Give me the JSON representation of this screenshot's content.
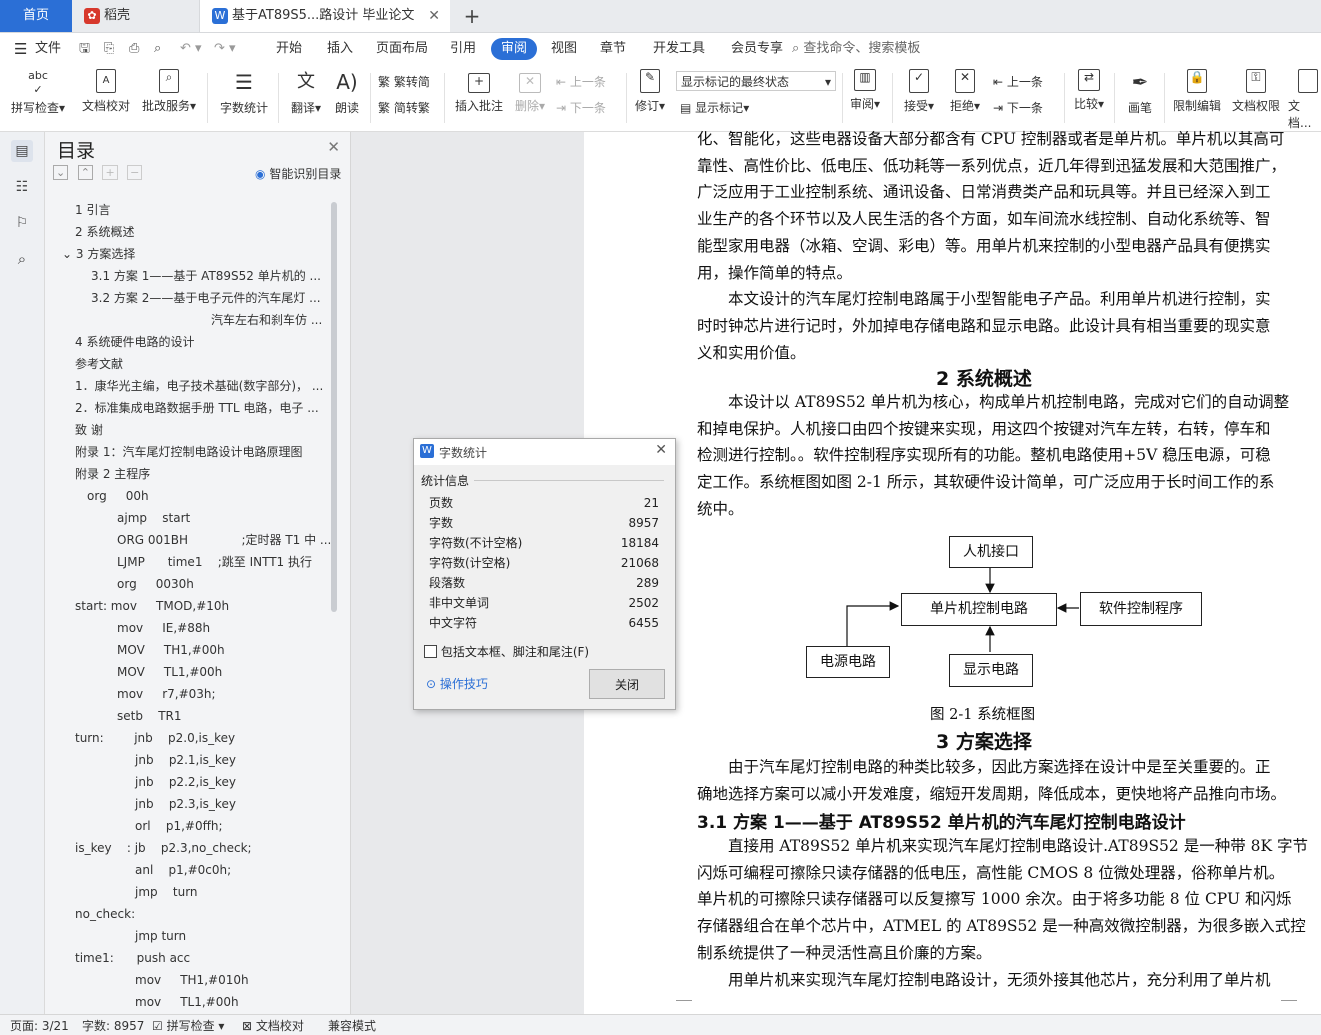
{
  "tabs": [
    {
      "label": "首页"
    },
    {
      "label": "稻壳"
    },
    {
      "label": "基于AT89S5...路设计 毕业论文"
    }
  ],
  "menu": [
    "文件",
    "开始",
    "插入",
    "页面布局",
    "引用",
    "审阅",
    "视图",
    "章节",
    "开发工具",
    "会员专享"
  ],
  "menu_search": "查找命令、搜索模板",
  "ribbon": {
    "spell": "拼写检查",
    "proof": "文档校对",
    "annotate": "批改服务",
    "wordcount": "字数统计",
    "translate": "翻译",
    "read": "朗读",
    "to_trad": "繁转简",
    "to_simp": "简转繁",
    "insert_comment": "插入批注",
    "delete": "删除",
    "prev": "上一条",
    "next": "下一条",
    "revise": "修订",
    "markup_state": "显示标记的最终状态",
    "show_markup": "显示标记",
    "review": "审阅",
    "accept": "接受",
    "reject": "拒绝",
    "prev2": "上一条",
    "next2": "下一条",
    "compare": "比较",
    "pen": "画笔",
    "restrict": "限制编辑",
    "permission": "文档权限",
    "doc_cut": "文档..."
  },
  "toc": {
    "title": "目录",
    "smart": "智能识别目录",
    "items": [
      "1 引言",
      "2 系统概述",
      "3 方案选择",
      "3.1 方案 1——基于 AT89S52 单片机的 ...",
      "3.2 方案 2——基于电子元件的汽车尾灯 ...",
      "汽车左右和刹车仿 ...",
      "4 系统硬件电路的设计",
      "参考文献",
      "1．康华光主编，电子技术基础(数字部分)， ...",
      "2．标准集成电路数据手册 TTL 电路，电子 ...",
      "致 谢",
      "附录 1：汽车尾灯控制电路设计电路原理图",
      "附录 2 主程序",
      "org     00h",
      "ajmp    start",
      "ORG 001BH              ;定时器 T1 中 ...",
      "LJMP      time1    ;跳至 INTT1 执行",
      "org     0030h",
      "start: mov     TMOD,#10h",
      "mov     IE,#88h",
      "MOV     TH1,#00h",
      "MOV     TL1,#00h",
      "mov     r7,#03h;",
      "setb    TR1",
      "turn:        jnb    p2.0,is_key",
      "jnb    p2.1,is_key",
      "jnb    p2.2,is_key",
      "jnb    p2.3,is_key",
      "orl    p1,#0ffh;",
      "is_key    : jb    p2.3,no_check;",
      "anl    p1,#0c0h;",
      "jmp    turn",
      "no_check:",
      "jmp turn",
      "time1:      push acc",
      "mov     TH1,#010h",
      "mov     TL1,#00h"
    ]
  },
  "doc": {
    "p1_lines": [
      "化、智能化，这些电器设备大部分都含有 CPU 控制器或者是单片机。单片机以其高可",
      "靠性、高性价比、低电压、低功耗等一系列优点，近几年得到迅猛发展和大范围推广，",
      "广泛应用于工业控制系统、通讯设备、日常消费类产品和玩具等。并且已经深入到工",
      "业生产的各个环节以及人民生活的各个方面，如车间流水线控制、自动化系统等、智",
      "能型家用电器（冰箱、空调、彩电）等。用单片机来控制的小型电器产品具有便携实",
      "用，操作简单的特点。"
    ],
    "p2_lines": [
      "本文设计的汽车尾灯控制电路属于小型智能电子产品。利用单片机进行控制，实",
      "时时钟芯片进行记时，外加掉电存储电路和显示电路。此设计具有相当重要的现实意",
      "义和实用价值。"
    ],
    "h2": "2 系统概述",
    "p3_lines": [
      "本设计以 AT89S52 单片机为核心，构成单片机控制电路，完成对它们的自动调整",
      "和掉电保护。人机接口由四个按键来实现，用这四个按键对汽车左转，右转，停车和",
      "检测进行控制。。软件控制程序实现所有的功能。整机电路使用+5V 稳压电源，可稳",
      "定工作。系统框图如图 2-1 所示，其软硬件设计简单，可广泛应用于长时间工作的系",
      "统中。"
    ],
    "diagram": {
      "hmi": "人机接口",
      "mcu": "单片机控制电路",
      "software": "软件控制程序",
      "power": "电源电路",
      "display": "显示电路",
      "caption": "图 2-1 系统框图"
    },
    "h3": "3 方案选择",
    "p4_lines": [
      "由于汽车尾灯控制电路的种类比较多，因此方案选择在设计中是至关重要的。正",
      "确地选择方案可以减小开发难度，缩短开发周期，降低成本，更快地将产品推向市场。"
    ],
    "h31": "3.1 方案 1——基于 AT89S52 单片机的汽车尾灯控制电路设计",
    "p5_lines": [
      "直接用 AT89S52 单片机来实现汽车尾灯控制电路设计.AT89S52 是一种带 8K 字节",
      "闪烁可编程可擦除只读存储器的低电压，高性能 CMOS 8 位微处理器，俗称单片机。",
      "单片机的可擦除只读存储器可以反复擦写 1000 余次。由于将多功能 8 位 CPU 和闪烁",
      "存储器组合在单个芯片中，ATMEL 的 AT89S52 是一种高效微控制器，为很多嵌入式控",
      "制系统提供了一种灵活性高且价廉的方案。"
    ],
    "p6_lines": [
      "用单片机来实现汽车尾灯控制电路设计，无须外接其他芯片，充分利用了单片机"
    ]
  },
  "dialog": {
    "title": "字数统计",
    "section": "统计信息",
    "rows": [
      {
        "label": "页数",
        "value": "21"
      },
      {
        "label": "字数",
        "value": "8957"
      },
      {
        "label": "字符数(不计空格)",
        "value": "18184"
      },
      {
        "label": "字符数(计空格)",
        "value": "21068"
      },
      {
        "label": "段落数",
        "value": "289"
      },
      {
        "label": "非中文单词",
        "value": "2502"
      },
      {
        "label": "中文字符",
        "value": "6455"
      }
    ],
    "checkbox": "包括文本框、脚注和尾注(F)",
    "tips": "操作技巧",
    "close": "关闭"
  },
  "status": {
    "page": "页面: 3/21",
    "words": "字数: 8957",
    "spell": "拼写检查",
    "proof": "文档校对",
    "compat": "兼容模式"
  },
  "colors": {
    "accent": "#2b6fd6"
  }
}
